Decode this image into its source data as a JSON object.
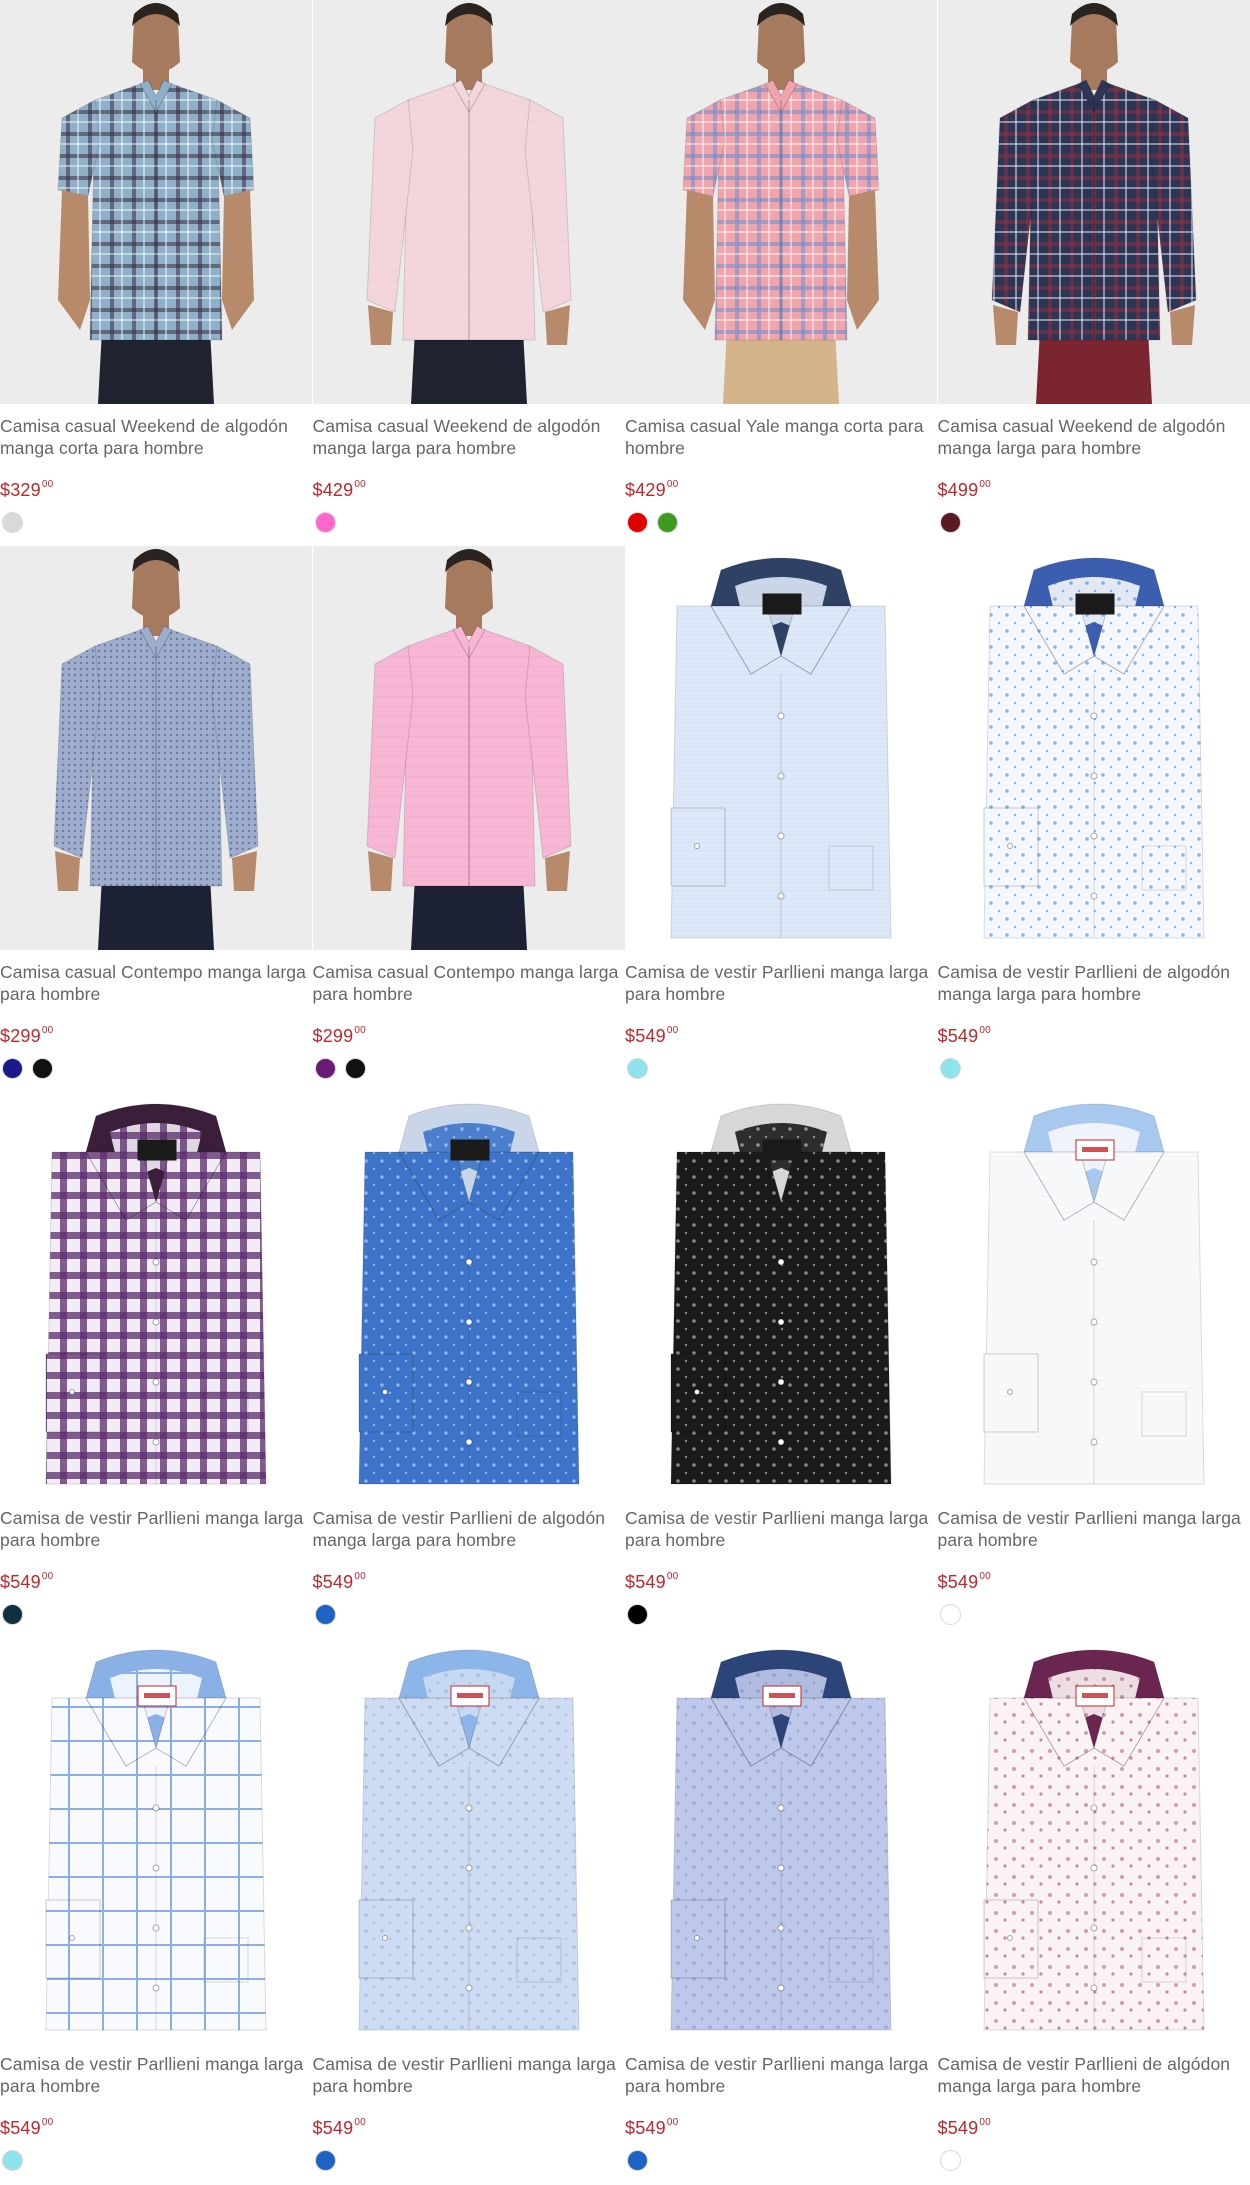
{
  "currency_symbol": "$",
  "products": [
    {
      "name": "Camisa casual Weekend de algodón manga corta para hombre",
      "price": "329",
      "cents": "00",
      "photo": "model",
      "pattern": "plaid",
      "shirt": "#8fb0c9",
      "accent": "#3a2c3c",
      "collar": "#8fb0c9",
      "pants": "#1f2330",
      "sleeve": "short",
      "colors": [
        "#d9d9d9"
      ]
    },
    {
      "name": "Camisa casual Weekend de algodón manga larga para hombre",
      "price": "429",
      "cents": "00",
      "photo": "model",
      "pattern": "solid",
      "shirt": "#f3d6dc",
      "accent": "#e9c3ca",
      "collar": "#f3d6dc",
      "pants": "#1f2330",
      "sleeve": "long",
      "colors": [
        "#ff66cc"
      ]
    },
    {
      "name": "Camisa casual Yale manga corta para hombre",
      "price": "429",
      "cents": "00",
      "photo": "model",
      "pattern": "plaid",
      "shirt": "#f0a5ad",
      "accent": "#6d8ed0",
      "collar": "#f0a5ad",
      "pants": "#d4b48a",
      "sleeve": "short",
      "colors": [
        "#e00000",
        "#3e9b1f"
      ]
    },
    {
      "name": "Camisa casual Weekend de algodón manga larga para hombre",
      "price": "499",
      "cents": "00",
      "photo": "model",
      "pattern": "plaid",
      "shirt": "#2d3557",
      "accent": "#8a3040",
      "collar": "#2d3557",
      "pants": "#7a2530",
      "sleeve": "long",
      "colors": [
        "#5a1a22"
      ]
    },
    {
      "name": "Camisa casual Contempo manga larga para hombre",
      "price": "299",
      "cents": "00",
      "photo": "model",
      "pattern": "dots",
      "shirt": "#9eadcc",
      "accent": "#6a7ca6",
      "collar": "#9eadcc",
      "pants": "#1c2233",
      "sleeve": "long",
      "colors": [
        "#1a1a8c",
        "#111111"
      ]
    },
    {
      "name": "Camisa casual Contempo manga larga para hombre",
      "price": "299",
      "cents": "00",
      "photo": "model",
      "pattern": "solid",
      "shirt": "#f6b6d4",
      "accent": "#e9a0c2",
      "collar": "#f6b6d4",
      "pants": "#1c2233",
      "sleeve": "long",
      "colors": [
        "#6a1a72",
        "#111111"
      ]
    },
    {
      "name": "Camisa de vestir Parllieni manga larga para hombre",
      "price": "549",
      "cents": "00",
      "photo": "flat",
      "pattern": "solid",
      "shirt": "#dce8f7",
      "accent": "#c5d6ec",
      "collar": "#2f4266",
      "label": "dark",
      "colors": [
        "#8ee3ec"
      ]
    },
    {
      "name": "Camisa de vestir Parllieni de algodón manga larga para hombre",
      "price": "549",
      "cents": "00",
      "photo": "flat",
      "pattern": "dots",
      "shirt": "#f4f8fd",
      "accent": "#8ab4e8",
      "collar": "#3b5fae",
      "label": "dark",
      "colors": [
        "#8ee3ec"
      ]
    },
    {
      "name": "Camisa de vestir Parllieni manga larga para hombre",
      "price": "549",
      "cents": "00",
      "photo": "flat",
      "pattern": "plaid",
      "shirt": "#d6c7e0",
      "accent": "#5b2a6e",
      "collar": "#3a1e3a",
      "label": "dark",
      "colors": [
        "#0f3040"
      ]
    },
    {
      "name": "Camisa de vestir Parllieni de algodón manga larga para hombre",
      "price": "549",
      "cents": "00",
      "photo": "flat",
      "pattern": "dots",
      "shirt": "#3d74c9",
      "accent": "#8fb3e6",
      "collar": "#c9d6ea",
      "label": "dark",
      "colors": [
        "#1e63c4"
      ]
    },
    {
      "name": "Camisa de vestir Parllieni manga larga para hombre",
      "price": "549",
      "cents": "00",
      "photo": "flat",
      "pattern": "dots",
      "shirt": "#1a1a1a",
      "accent": "#8a8a8a",
      "collar": "#d7d7d7",
      "label": "dark",
      "colors": [
        "#000000"
      ]
    },
    {
      "name": "Camisa de vestir Parllieni manga larga para hombre",
      "price": "549",
      "cents": "00",
      "photo": "flat",
      "pattern": "solid",
      "shirt": "#f8f9fb",
      "accent": "#e8ecf2",
      "collar": "#a8c8ef",
      "label": "red",
      "colors": [
        "#ffffff"
      ]
    },
    {
      "name": "Camisa de vestir Parllieni manga larga para hombre",
      "price": "549",
      "cents": "00",
      "photo": "flat",
      "pattern": "window",
      "shirt": "#f8fafe",
      "accent": "#8ab0e6",
      "collar": "#8ab0e6",
      "label": "red",
      "colors": [
        "#8ee3ec"
      ]
    },
    {
      "name": "Camisa de vestir Parllieni manga larga para hombre",
      "price": "549",
      "cents": "00",
      "photo": "flat",
      "pattern": "dots",
      "shirt": "#cddcf3",
      "accent": "#a9c0e6",
      "collar": "#8cb6ea",
      "label": "red",
      "colors": [
        "#1e63c4"
      ]
    },
    {
      "name": "Camisa de vestir Parllieni manga larga para hombre",
      "price": "549",
      "cents": "00",
      "photo": "flat",
      "pattern": "dots",
      "shirt": "#bdc8ea",
      "accent": "#98a8d8",
      "collar": "#2d4478",
      "label": "red",
      "colors": [
        "#1e63c4"
      ]
    },
    {
      "name": "Camisa de vestir Parllieni de algódon manga larga para hombre",
      "price": "549",
      "cents": "00",
      "photo": "flat",
      "pattern": "floral",
      "shirt": "#fbf2f4",
      "accent": "#c47a92",
      "collar": "#6a2550",
      "label": "red",
      "colors": [
        "#ffffff"
      ]
    }
  ]
}
